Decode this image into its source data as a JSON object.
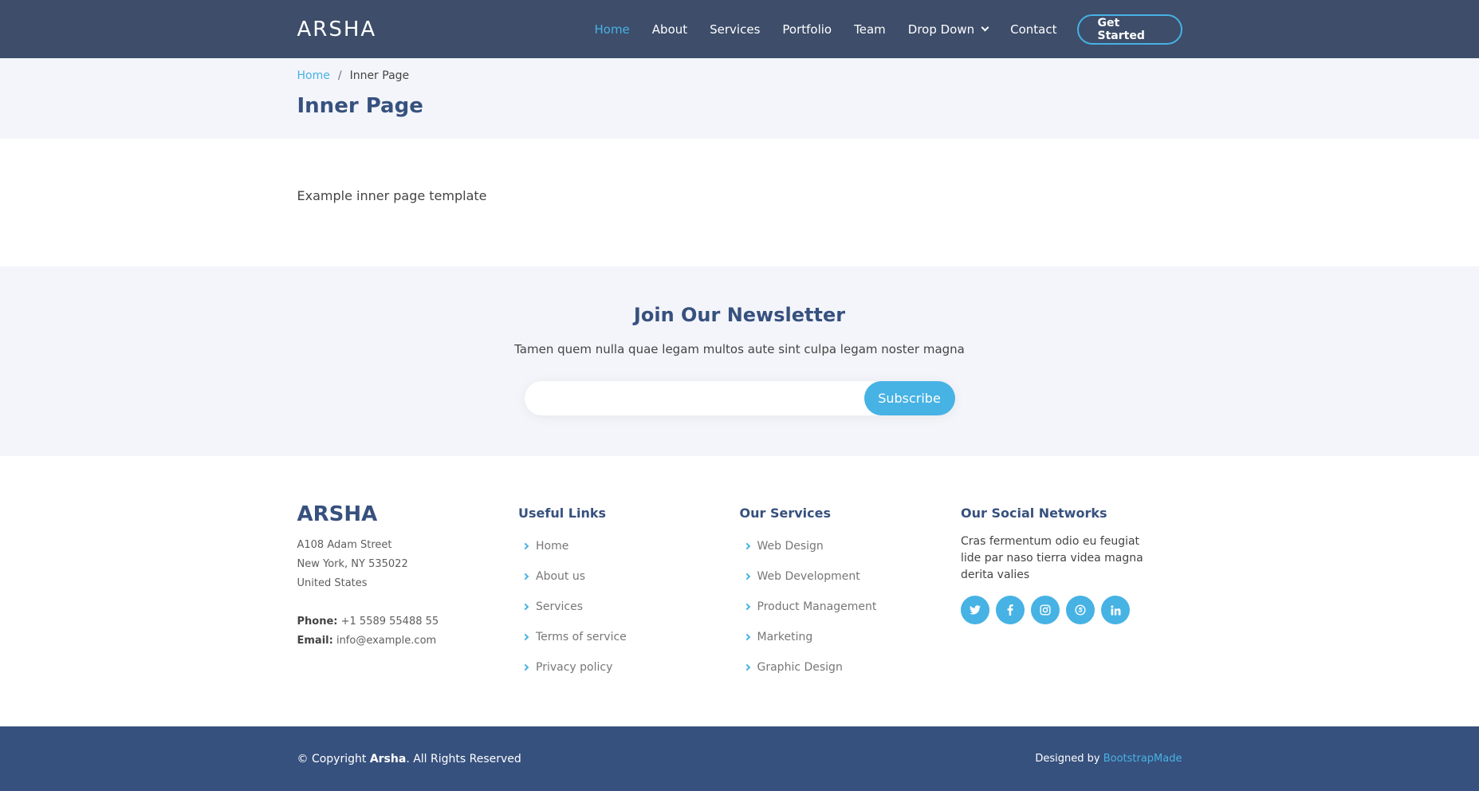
{
  "header": {
    "logo": "ARSHA",
    "nav": [
      "Home",
      "About",
      "Services",
      "Portfolio",
      "Team",
      "Drop Down",
      "Contact"
    ],
    "cta": "Get Started"
  },
  "breadcrumb": {
    "home": "Home",
    "separator": "/",
    "current": "Inner Page"
  },
  "page_title": "Inner Page",
  "content": {
    "text": "Example inner page template"
  },
  "newsletter": {
    "title": "Join Our Newsletter",
    "subtitle": "Tamen quem nulla quae legam multos aute sint culpa legam noster magna",
    "email_value": "",
    "button": "Subscribe"
  },
  "footer": {
    "logo": "ARSHA",
    "address1": "A108 Adam Street",
    "address2": "New York, NY 535022",
    "address3": "United States",
    "phone_label": "Phone:",
    "phone": "+1 5589 55488 55",
    "email_label": "Email:",
    "email": "info@example.com",
    "useful_title": "Useful Links",
    "useful": [
      "Home",
      "About us",
      "Services",
      "Terms of service",
      "Privacy policy"
    ],
    "services_title": "Our Services",
    "services": [
      "Web Design",
      "Web Development",
      "Product Management",
      "Marketing",
      "Graphic Design"
    ],
    "social_title": "Our Social Networks",
    "social_text": "Cras fermentum odio eu feugiat lide par naso tierra videa magna derita valies",
    "social_icons": [
      "twitter-icon",
      "facebook-icon",
      "instagram-icon",
      "skype-icon",
      "linkedin-icon"
    ]
  },
  "bottom": {
    "copy_prefix": "© Copyright ",
    "brand": "Arsha",
    "copy_suffix": ". All Rights Reserved",
    "designed": "Designed by ",
    "designer": "BootstrapMade"
  },
  "colors": {
    "header_bg": "#3d4d6a",
    "accent": "#47b2e4",
    "brand": "#37517e",
    "light_bg": "#f3f5fa"
  }
}
